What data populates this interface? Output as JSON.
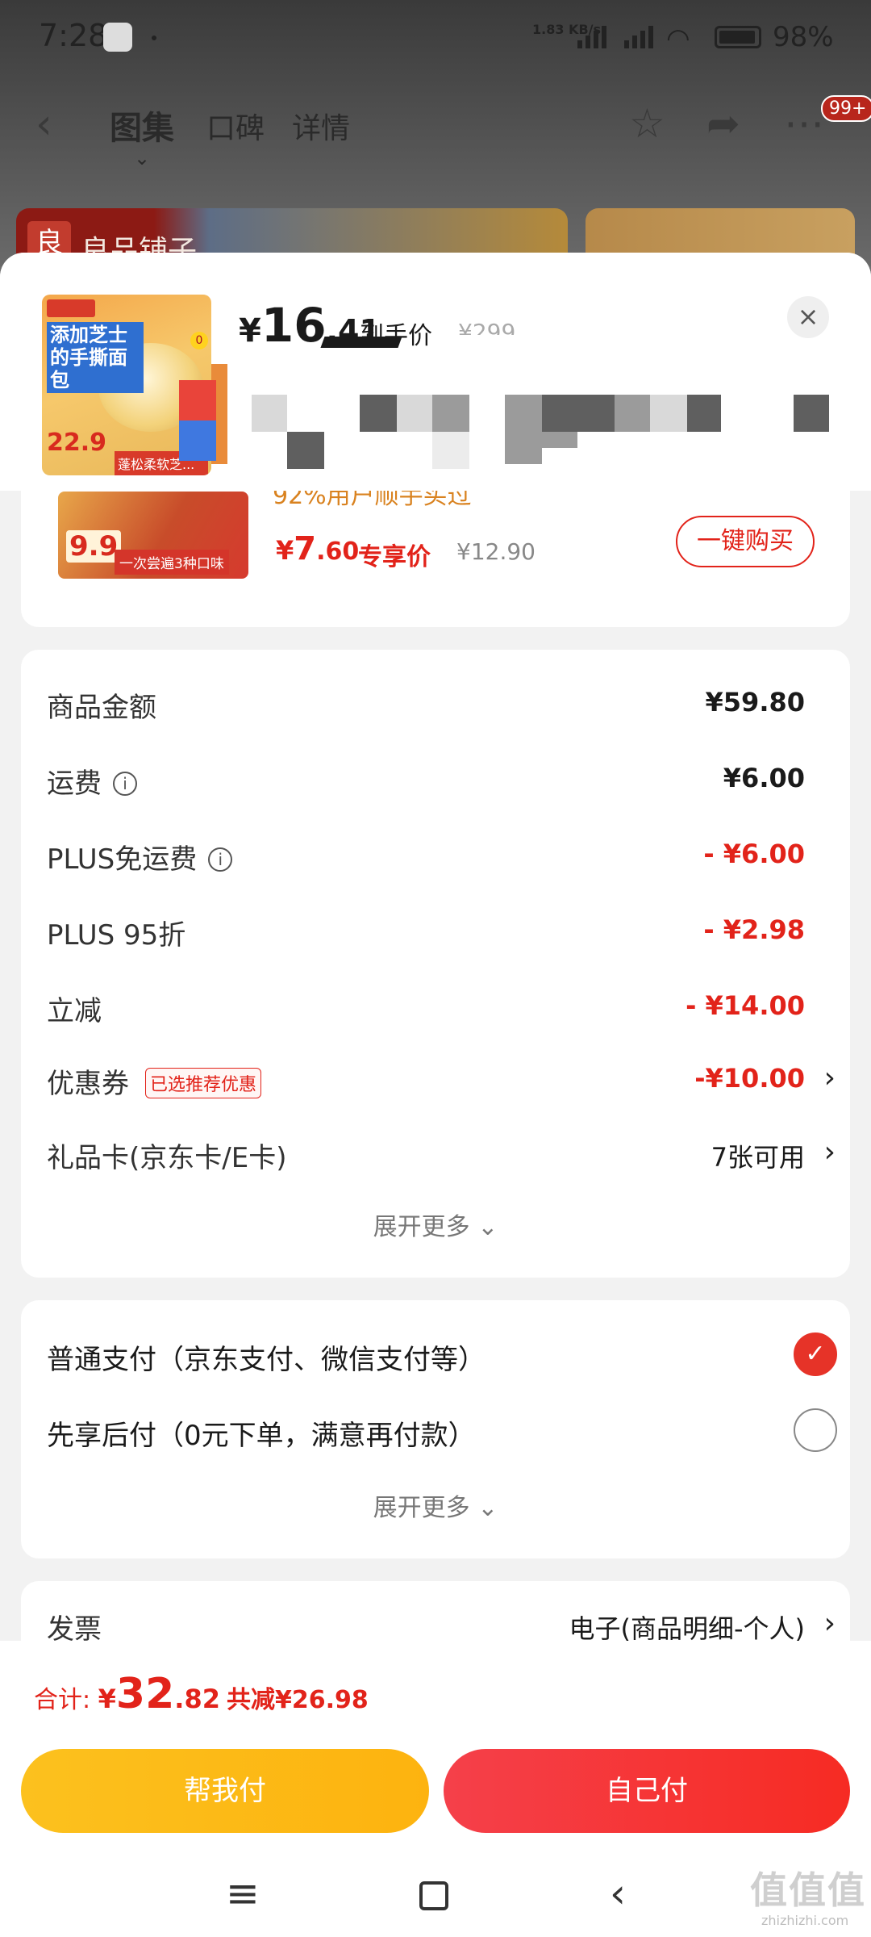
{
  "status_bar": {
    "time": "7:28",
    "network_speed": "1.83 KB/s",
    "battery": "98%",
    "icons": [
      "baidu-app-icon",
      "signal-icon",
      "signal-icon",
      "wifi-icon",
      "battery-icon"
    ]
  },
  "nav": {
    "tabs": [
      "图集",
      "口碑",
      "详情"
    ],
    "active_tab": "图集",
    "badge": "99+"
  },
  "background": {
    "store_name": "良品铺子"
  },
  "sheet": {
    "price_currency": "¥",
    "price_int": "16",
    "price_dec": ".41",
    "price_label": "到手价",
    "original_price": "¥299",
    "close_symbol": "×",
    "thumb": {
      "caption": "添加芝士的手撕面包",
      "price": "22.9",
      "tag": "蓬松柔软芝..."
    }
  },
  "recommend": {
    "bought_text": "92%用户顺手买过",
    "price_currency": "¥",
    "price_int": "7",
    "price_dec": ".60",
    "exclusive_label": "专享价",
    "original_price": "¥12.90",
    "buy_button": "一键购买",
    "thumb_price": "9.9",
    "thumb_tag": "一次尝遍3种口味"
  },
  "price_details": {
    "goods_amount_label": "商品金额",
    "goods_amount": "¥59.80",
    "shipping_label": "运费",
    "shipping": "¥6.00",
    "plus_free_shipping_label": "PLUS免运费",
    "plus_free_shipping": "- ¥6.00",
    "plus_discount_label": "PLUS 95折",
    "plus_discount": "- ¥2.98",
    "instant_reduction_label": "立减",
    "instant_reduction": "- ¥14.00",
    "coupon_label": "优惠券",
    "coupon_tag": "已选推荐优惠",
    "coupon": "-¥10.00",
    "gift_card_label": "礼品卡(京东卡/E卡)",
    "gift_card": "7张可用",
    "expand_more": "展开更多 ⌄"
  },
  "payment": {
    "options": [
      {
        "label": "普通支付（京东支付、微信支付等）",
        "selected": true
      },
      {
        "label": "先享后付（0元下单，满意再付款）",
        "selected": false
      }
    ],
    "expand_more": "展开更多 ⌄"
  },
  "invoice": {
    "label": "发票",
    "value": "电子(商品明细-个人)"
  },
  "bottom": {
    "total_label": "合计: ",
    "total_currency": "¥",
    "total_int": "32",
    "total_dec": ".82",
    "saved": "共减¥26.98",
    "help_pay": "帮我付",
    "self_pay": "自己付"
  },
  "watermark": {
    "logo": "值值值",
    "site": "zhizhizhi.com"
  },
  "colors": {
    "accent_red": "#e2231a",
    "help_yellow": "#fcc11e",
    "self_red": "#f5404a"
  }
}
